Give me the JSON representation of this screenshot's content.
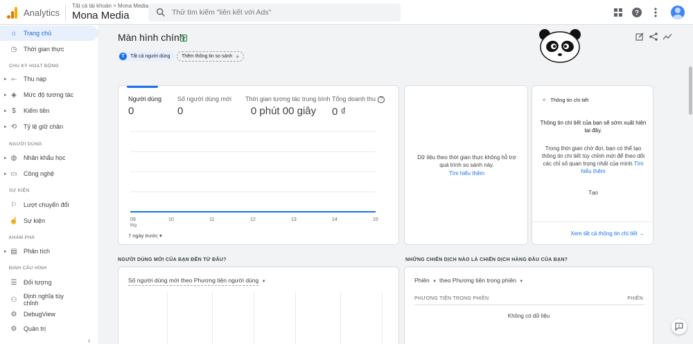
{
  "header": {
    "app_title": "Analytics",
    "breadcrumb": "Tất cả tài khoản > Mona Media",
    "property": "Mona Media",
    "search_placeholder": "Thử tìm kiếm \"liên kết với Ads\""
  },
  "sidebar": {
    "items": [
      {
        "label": "Trang chủ",
        "icon": "home-icon"
      },
      {
        "label": "Thời gian thực",
        "icon": "clock-icon"
      }
    ],
    "sections": [
      {
        "title": "CHU KỲ HOẠT ĐỘNG",
        "items": [
          "Thu nạp",
          "Mức độ tương tác",
          "Kiếm tiền",
          "Tỷ lệ giữ chân"
        ]
      },
      {
        "title": "NGƯỜI DÙNG",
        "items": [
          "Nhân khẩu học",
          "Công nghệ"
        ]
      },
      {
        "title": "SỰ KIỆN",
        "items": [
          "Lượt chuyển đổi",
          "Sự kiện"
        ]
      },
      {
        "title": "KHÁM PHÁ",
        "items": [
          "Phân tích"
        ]
      },
      {
        "title": "ĐỊNH CẤU HÌNH",
        "items": [
          "Đối tượng",
          "Định nghĩa tùy chỉnh",
          "DebugView",
          "Quản trị"
        ]
      }
    ]
  },
  "main": {
    "title": "Màn hình chính",
    "chip_all": "Tất cả người dùng",
    "chip_all_letter": "T",
    "chip_compare": "Thêm thông tin so sánh"
  },
  "metrics": [
    {
      "label": "Người dùng",
      "value": "0"
    },
    {
      "label": "Số người dùng mới",
      "value": "0"
    },
    {
      "label": "Thời gian tương tác trung bình",
      "value": "0 phút 00 giây"
    },
    {
      "label": "Tổng doanh thu",
      "value": "0 ₫"
    }
  ],
  "chart_data": {
    "type": "line",
    "x": [
      "09 thg",
      "10",
      "11",
      "12",
      "13",
      "14",
      "15"
    ],
    "series": [
      {
        "values": [
          0,
          0,
          0,
          0,
          0,
          0,
          0
        ]
      }
    ],
    "color": "#1a73e8"
  },
  "range": "7 ngày trước",
  "realtime": {
    "text": "Dữ liệu theo thời gian thực không hỗ trợ quá trình so sánh này.",
    "link": "Tìm hiểu thêm"
  },
  "insights": {
    "header": "Thông tin chi tiết",
    "title": "Thông tin chi tiết của bạn sẽ sớm xuất hiện tại đây.",
    "body": "Trong thời gian chờ đợi, bạn có thể tạo thông tin chi tiết tùy chỉnh mới để theo dõi các chỉ số quan trọng nhất của mình.",
    "body_link": "Tìm hiểu thêm",
    "create": "Tạo",
    "footer_link": "Xem tất cả thông tin chi tiết"
  },
  "bottom": {
    "left_heading": "NGƯỜI DÙNG MỚI CỦA BẠN ĐẾN TỪ ĐÂU?",
    "right_heading": "NHỮNG CHIẾN DỊCH NÀO LÀ CHIẾN DỊCH HÀNG ĐẦU CỦA BẠN?",
    "left_dropdown": "Số người dùng mới theo Phương tiện người dùng",
    "right_dropdown_1": "Phiên",
    "right_dropdown_2": "theo Phương tiện trong phiên",
    "col_left": "PHƯƠNG TIỆN TRONG PHIÊN",
    "col_right": "PHIÊN",
    "no_data": "Không có dữ liệu"
  },
  "colors": {
    "accent": "#1a73e8",
    "active_bg": "#e8f0fe",
    "logo_orange": "#e37400",
    "logo_yellow": "#f9ab00"
  }
}
